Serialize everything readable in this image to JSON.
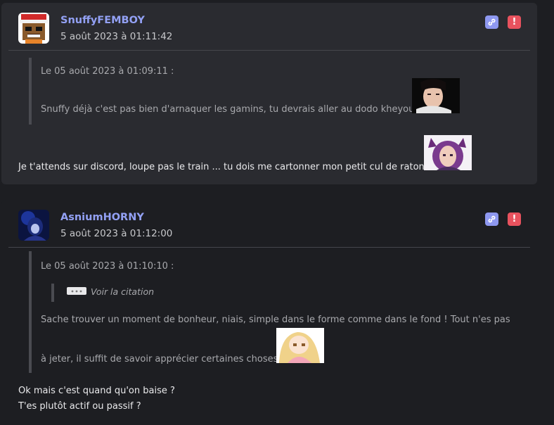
{
  "posts": [
    {
      "author": "SnuffyFEMBOY",
      "date": "5 août 2023 à 01:11:42",
      "quote": {
        "header": "Le 05 août 2023 à 01:09:11 :",
        "text": "Snuffy déjà c'est pas bien d'arnaquer les gamins, tu devrais aller au dodo kheyou"
      },
      "message": "Je t'attends sur discord, loupe pas le train ... tu dois me cartonner mon petit cul de raton"
    },
    {
      "author": "AsniumHORNY",
      "date": "5 août 2023 à 01:12:00",
      "quote": {
        "header": "Le 05 août 2023 à 01:10:10 :",
        "nested_label": "Voir la citation",
        "line1": "Sache trouver un moment de bonheur, niais, simple dans le forme comme dans le fond ! Tout n'es pas",
        "line2": "à jeter, il suffit de savoir apprécier certaines choses"
      },
      "message_line1": "Ok mais c'est quand qu'on baise ?",
      "message_line2": "T'es plutôt actif ou passif ?"
    }
  ],
  "icons": {
    "permalink": "link-icon",
    "report": "exclamation-icon"
  },
  "colors": {
    "author": "#93a1f5",
    "link_button": "#8e98f0",
    "report_button": "#e8525e",
    "card": "#2a2b30",
    "background": "#1d1e22"
  }
}
